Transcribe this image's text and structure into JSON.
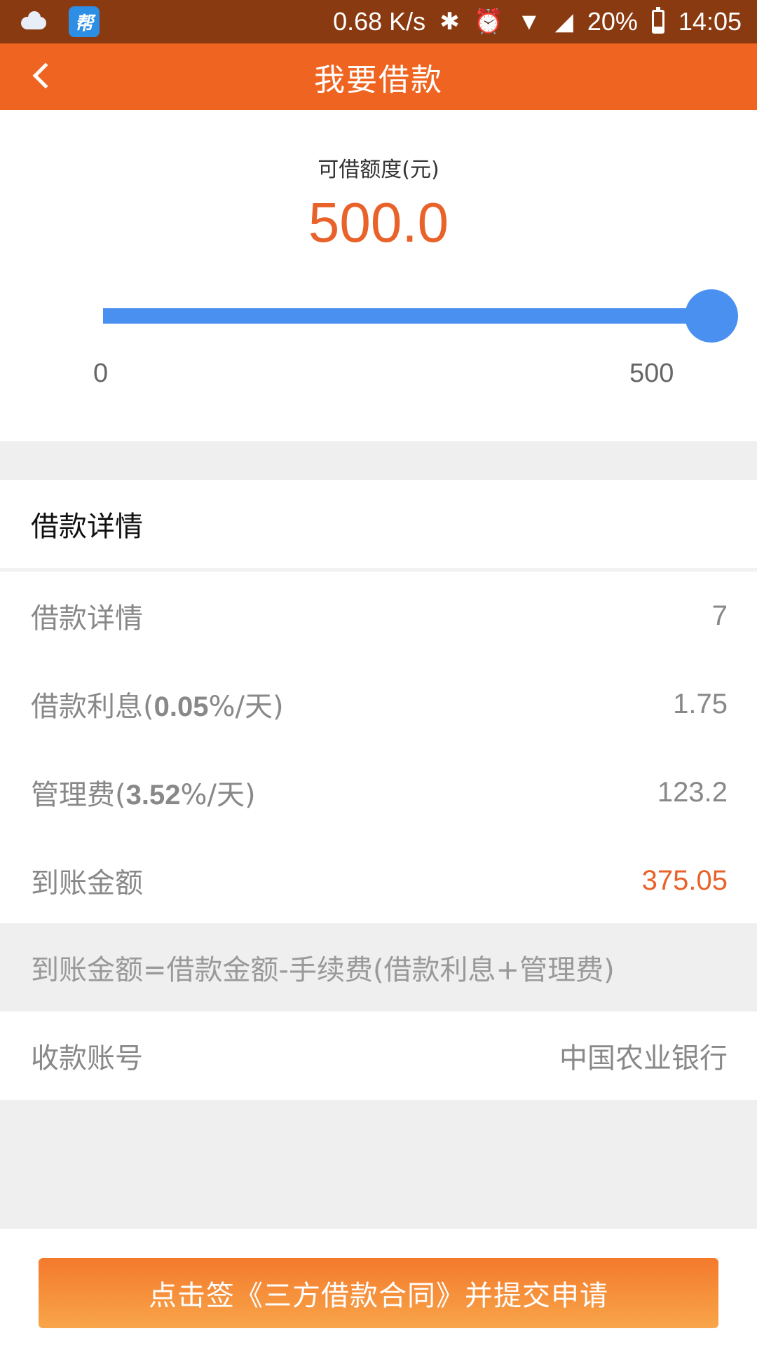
{
  "status_bar": {
    "network_speed": "0.68 K/s",
    "battery": "20%",
    "time": "14:05",
    "icons": [
      "cloud-icon",
      "app-badge-icon",
      "bluetooth-icon",
      "alarm-icon",
      "wifi-icon",
      "signal-icon",
      "battery-icon"
    ]
  },
  "app_bar": {
    "title": "我要借款",
    "back_icon": "chevron-left-icon"
  },
  "quota": {
    "label": "可借额度(元)",
    "value": "500.0",
    "slider_min": "0",
    "slider_max": "500",
    "slider_fraction": 1.0,
    "accent_color": "#4a90f0"
  },
  "details": {
    "header": "借款详情",
    "rows": [
      {
        "label": "借款详情",
        "value": "7"
      },
      {
        "label_prefix": "借款利息(",
        "label_rate": "0.05",
        "label_suffix": "%/天)",
        "value": "1.75"
      },
      {
        "label_prefix": "管理费(",
        "label_rate": "3.52",
        "label_suffix": "%/天)",
        "value": "123.2"
      },
      {
        "label": "到账金额",
        "value": "375.05"
      }
    ],
    "formula": "到账金额=借款金额-手续费(借款利息+管理费)",
    "account_label": "收款账号",
    "account_value": "中国农业银行"
  },
  "submit": {
    "label": "点击签《三方借款合同》并提交申请"
  },
  "colors": {
    "primary": "#ef6420",
    "status_bar": "#8a3a10",
    "highlight": "#e8622a"
  }
}
